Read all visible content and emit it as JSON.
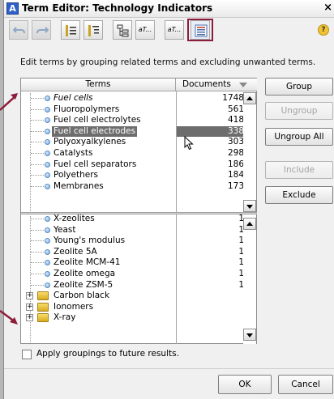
{
  "window": {
    "title": "Term Editor: Technology Indicators",
    "close_glyph": "×"
  },
  "toolbar": {
    "icons": [
      "undo-icon",
      "redo-icon",
      "collapse-icon",
      "expand-icon",
      "tree-view-icon",
      "term-text-icon",
      "term-text-small-icon",
      "list-view-icon"
    ],
    "text_btn_label": "aT...",
    "text_btn2_label": "aT...",
    "help_glyph": "?"
  },
  "instructions": "Edit terms by grouping related terms and excluding unwanted terms.",
  "columns": {
    "terms": "Terms",
    "documents": "Documents"
  },
  "upper_rows": [
    {
      "term": "Fuel cells",
      "count": "1748",
      "italic": true
    },
    {
      "term": "Fluoropolymers",
      "count": "561"
    },
    {
      "term": "Fuel cell electrolytes",
      "count": "418"
    },
    {
      "term": "Fuel cell electrodes",
      "count": "338",
      "selected": true
    },
    {
      "term": "Polyoxyalkylenes",
      "count": "303"
    },
    {
      "term": "Catalysts",
      "count": "298"
    },
    {
      "term": "Fuel cell separators",
      "count": "186"
    },
    {
      "term": "Polyethers",
      "count": "184"
    },
    {
      "term": "Membranes",
      "count": "173"
    }
  ],
  "lower_rows": [
    {
      "term": "X-zeolites",
      "count": "1"
    },
    {
      "term": "Yeast",
      "count": "1"
    },
    {
      "term": "Young's modulus",
      "count": "1"
    },
    {
      "term": "Zeolite 5A",
      "count": "1"
    },
    {
      "term": "Zeolite MCM-41",
      "count": "1"
    },
    {
      "term": "Zeolite omega",
      "count": "1"
    },
    {
      "term": "Zeolite ZSM-5",
      "count": "1"
    },
    {
      "term": "Carbon black",
      "count": "",
      "group": true
    },
    {
      "term": "Ionomers",
      "count": "",
      "group": true
    },
    {
      "term": "X-ray",
      "count": "",
      "group": true
    }
  ],
  "expander_glyph": "+",
  "buttons": {
    "group": "Group",
    "ungroup": "Ungroup",
    "ungroup_all": "Ungroup All",
    "include": "Include",
    "exclude": "Exclude"
  },
  "checkbox_label": "Apply groupings to future results.",
  "ok": "OK",
  "cancel": "Cancel",
  "colors": {
    "highlight": "#8b1c3b",
    "selection": "#6d6d6d"
  }
}
